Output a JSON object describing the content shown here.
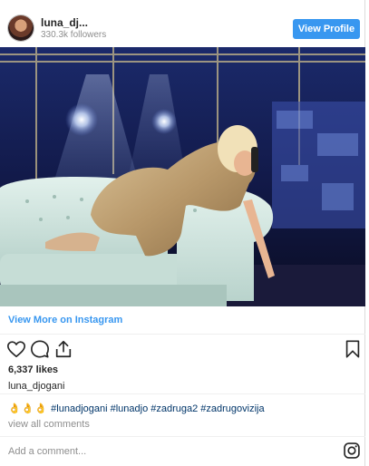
{
  "header": {
    "username": "luna_dj...",
    "followers": "330.3k followers",
    "view_profile_label": "View Profile"
  },
  "post": {
    "view_more_label": "View More on Instagram",
    "likes": "6,337 likes",
    "owner_username": "luna_djogani",
    "caption_prefix": "👌👌👌",
    "caption_tags": "#lunadjogani #lunadjo #zadruga2 #zadrugovizija",
    "view_all_comments": "view all comments",
    "add_comment_placeholder": "Add a comment..."
  },
  "icons": {
    "like": "heart-icon",
    "comment": "comment-icon",
    "share": "share-icon",
    "save": "bookmark-icon",
    "instagram": "instagram-icon"
  },
  "colors": {
    "accent": "#3897f0",
    "hashtag": "#003569",
    "muted": "#8e8e8e"
  }
}
